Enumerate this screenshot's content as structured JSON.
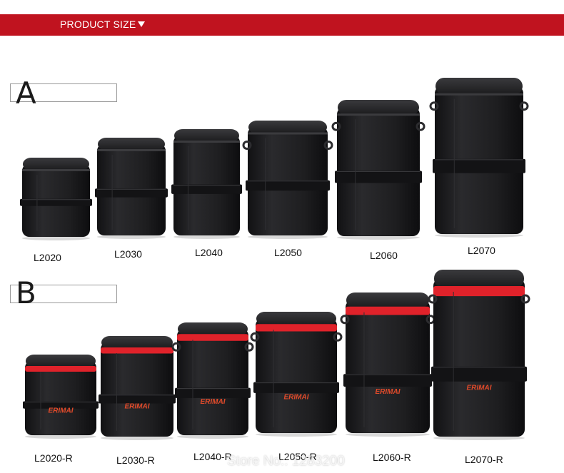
{
  "header": {
    "title": "PRODUCT SIZE"
  },
  "groups": [
    {
      "label": "A",
      "models": [
        "L2020",
        "L2030",
        "L2040",
        "L2050",
        "L2060",
        "L2070"
      ]
    },
    {
      "label": "B",
      "models": [
        "L2020-R",
        "L2030-R",
        "L2040-R",
        "L2050-R",
        "L2060-R",
        "L2070-R"
      ],
      "brand_mark": "ERIMAI"
    }
  ],
  "watermark": "Store No.: 1283200",
  "colors": {
    "banner": "#c0131f",
    "bag_body": "#1c1c1e",
    "zipper_red": "#e0222a"
  }
}
